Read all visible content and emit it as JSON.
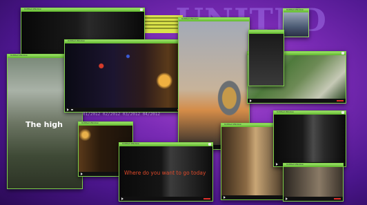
{
  "background_text": "UNITED",
  "colors": {
    "titlebar": "#7fd14a",
    "progress": "#e0302a",
    "wallpaper": "#7a2bb5"
  },
  "windows": {
    "top_left": {
      "title": "Untitled Window"
    },
    "night_city": {
      "title": "Untitled Window"
    },
    "street": {
      "title": "Untitled Window",
      "caption": "The high"
    },
    "airplane": {
      "title": "Untitled Window"
    },
    "trees": {
      "title": "Untitled Window"
    },
    "right_top_small": {
      "title": "Untitled Window"
    },
    "hotel_room": {
      "title": "Untitled Window"
    },
    "right_bottom": {
      "title": "Untitled Window"
    },
    "where_go": {
      "title": "Untitled Window",
      "caption": "Where do you want to go today"
    },
    "corridor": {
      "title": "Untitled Window"
    },
    "bottom_right_room": {
      "title": "Untitled Window"
    }
  },
  "overlay_numbers": "01/2012  02/2012  03/2012  04/2012"
}
